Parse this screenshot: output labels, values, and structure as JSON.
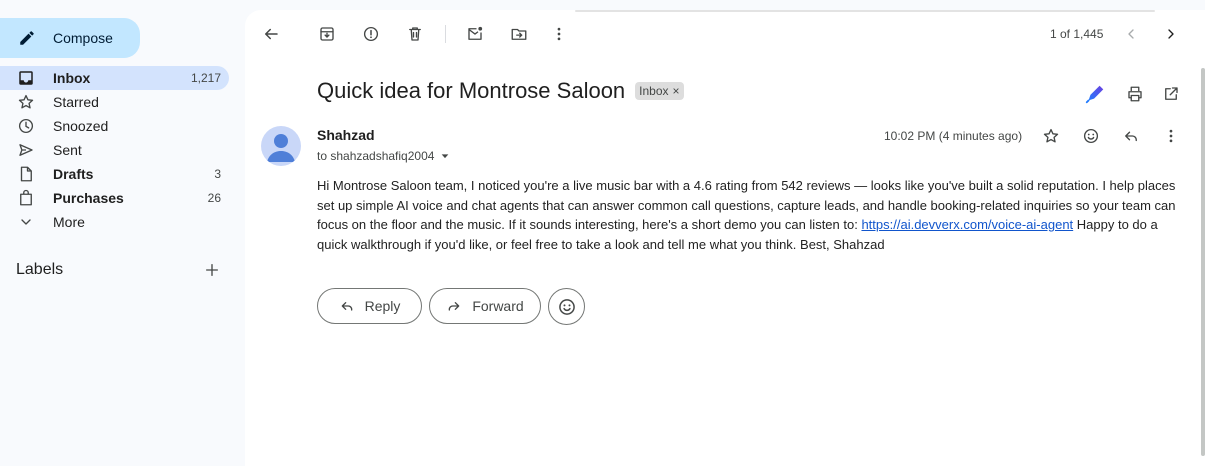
{
  "sidebar": {
    "compose_label": "Compose",
    "items": [
      {
        "label": "Inbox",
        "count": "1,217",
        "icon": "inbox-icon"
      },
      {
        "label": "Starred",
        "count": "",
        "icon": "star-icon"
      },
      {
        "label": "Snoozed",
        "count": "",
        "icon": "clock-icon"
      },
      {
        "label": "Sent",
        "count": "",
        "icon": "send-icon"
      },
      {
        "label": "Drafts",
        "count": "3",
        "icon": "draft-icon"
      },
      {
        "label": "Purchases",
        "count": "26",
        "icon": "shopping-bag-icon"
      },
      {
        "label": "More",
        "count": "",
        "icon": "chevron-down-icon"
      }
    ],
    "labels_title": "Labels"
  },
  "toolbar": {
    "pager": "1 of 1,445"
  },
  "message": {
    "subject": "Quick idea for Montrose Saloon",
    "label_chip": "Inbox",
    "chip_close": "×",
    "sender": "Shahzad",
    "recipient": "to shahzadshafiq2004",
    "time": "10:02 PM (4 minutes ago)",
    "body_before_link": "Hi Montrose Saloon team, I noticed you're a live music bar with a 4.6 rating from 542 reviews — looks like you've built a solid reputation. I help places set up simple AI voice and chat agents that can answer common call questions, capture leads, and handle booking-related inquiries so your team can focus on the floor and the music. If it sounds interesting, here's a short demo you can listen to: ",
    "link": "https://ai.devverx.com/voice-ai-agent",
    "body_after_link": " Happy to do a quick walkthrough if you'd like, or feel free to take a look and tell me what you think. Best, Shahzad"
  },
  "actions": {
    "reply": "Reply",
    "forward": "Forward"
  },
  "colors": {
    "compose_bg": "#c2e7ff",
    "active_nav_bg": "#d3e3fd",
    "link": "#1155cc",
    "accent_blue": "#0b57d0"
  }
}
